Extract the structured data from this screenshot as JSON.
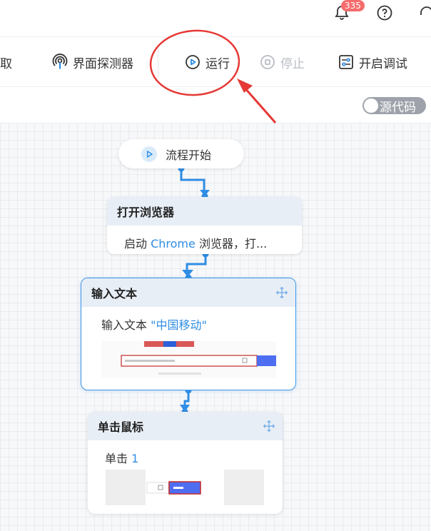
{
  "topbar": {
    "notification_count": "335",
    "icons": [
      "bell-icon",
      "help-icon",
      "headset-icon"
    ]
  },
  "toolbar": {
    "items": [
      {
        "label": "取",
        "icon": "capture-icon"
      },
      {
        "label": "界面探测器",
        "icon": "ui-detector-icon"
      },
      {
        "label": "运行",
        "icon": "play-icon"
      },
      {
        "label": "停止",
        "icon": "stop-icon",
        "disabled": true
      },
      {
        "label": "开启调试",
        "icon": "debug-icon"
      }
    ]
  },
  "source_toggle": {
    "label": "源代码",
    "on": false
  },
  "flow": {
    "start": {
      "label": "流程开始"
    },
    "nodes": [
      {
        "title": "打开浏览器",
        "desc_prefix": "启动 ",
        "desc_highlight": "Chrome",
        "desc_suffix": " 浏览器，打..."
      },
      {
        "title": "输入文本",
        "desc_prefix": "输入文本 ",
        "desc_highlight": "\"中国移动\"",
        "desc_suffix": ""
      },
      {
        "title": "单击鼠标",
        "desc_prefix": "单击 ",
        "desc_highlight": "1",
        "desc_suffix": ""
      }
    ]
  },
  "colors": {
    "accent": "#2f8de4",
    "annotation": "#e53935",
    "badge": "#f56c6c"
  }
}
